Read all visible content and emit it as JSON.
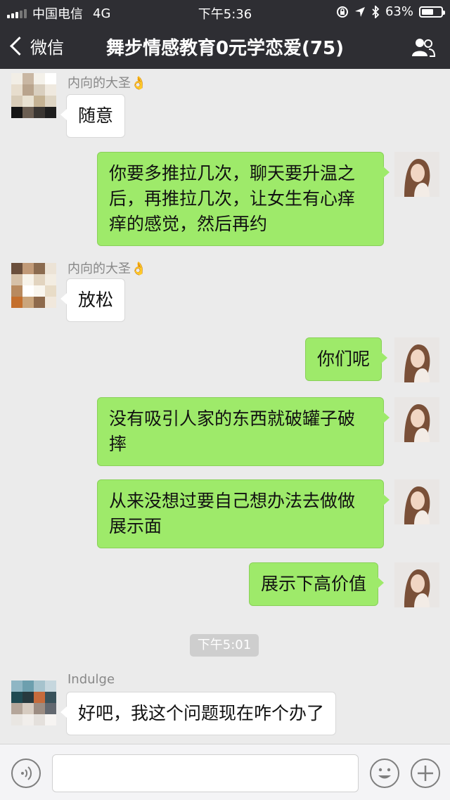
{
  "status_bar": {
    "carrier": "中国电信",
    "network": "4G",
    "time": "下午5:36",
    "battery": "63%",
    "battery_level": 0.63
  },
  "nav": {
    "back_label": "微信",
    "title": "舞步情感教育0元学恋爱(75)"
  },
  "messages": [
    {
      "side": "left",
      "sender": "内向的大圣👌",
      "text": "随意"
    },
    {
      "side": "right",
      "text": "你要多推拉几次，聊天要升温之后，再推拉几次，让女生有心痒痒的感觉，然后再约"
    },
    {
      "side": "left",
      "sender": "内向的大圣👌",
      "text": "放松"
    },
    {
      "side": "right",
      "text": "你们呢"
    },
    {
      "side": "right",
      "text": "没有吸引人家的东西就破罐子破摔"
    },
    {
      "side": "right",
      "text": "从来没想过要自己想办法去做做展示面"
    },
    {
      "side": "right",
      "text": "展示下高价值"
    },
    {
      "side": "left",
      "sender": "Indulge",
      "text": "好吧，我这个问题现在咋个办了"
    }
  ],
  "timestamp": "下午5:01",
  "input": {
    "value": "",
    "placeholder": ""
  },
  "icons": {
    "voice": "voice-icon",
    "emoji": "emoji-icon",
    "plus": "plus-icon",
    "people": "group-members-icon"
  },
  "colors": {
    "nav_bg": "#2e2e33",
    "my_bubble": "#9eea6a",
    "their_bubble": "#ffffff",
    "chat_bg": "#ebebeb"
  }
}
